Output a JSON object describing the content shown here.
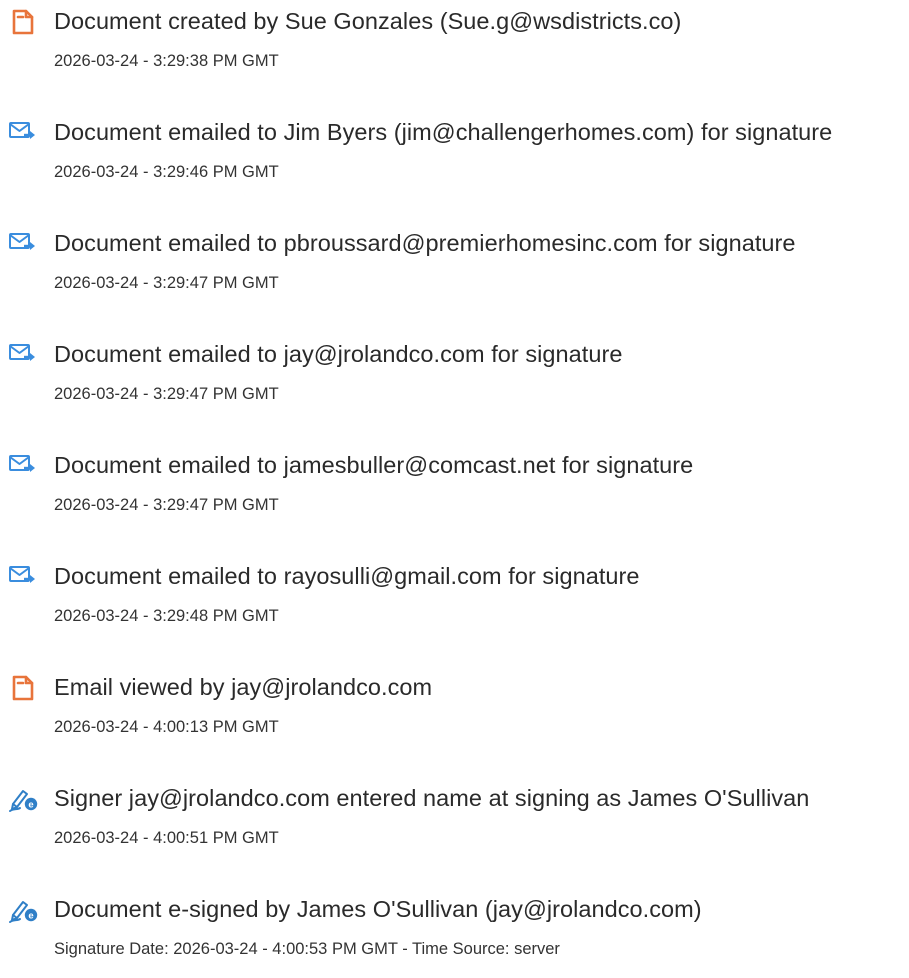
{
  "colors": {
    "doc_icon": "#e8743b",
    "email_icon": "#3a8dde",
    "sign_icon": "#2f7fc7",
    "text": "#2a2a2a"
  },
  "events": [
    {
      "icon": "document-icon",
      "title": "Document created by Sue Gonzales (Sue.g@wsdistricts.co)",
      "timestamp": "2026-03-24 - 3:29:38 PM GMT"
    },
    {
      "icon": "email-sent-icon",
      "title": "Document emailed to Jim Byers (jim@challengerhomes.com) for signature",
      "timestamp": "2026-03-24 - 3:29:46 PM GMT"
    },
    {
      "icon": "email-sent-icon",
      "title": "Document emailed to pbroussard@premierhomesinc.com for signature",
      "timestamp": "2026-03-24 - 3:29:47 PM GMT"
    },
    {
      "icon": "email-sent-icon",
      "title": "Document emailed to jay@jrolandco.com for signature",
      "timestamp": "2026-03-24 - 3:29:47 PM GMT"
    },
    {
      "icon": "email-sent-icon",
      "title": "Document emailed to jamesbuller@comcast.net for signature",
      "timestamp": "2026-03-24 - 3:29:47 PM GMT"
    },
    {
      "icon": "email-sent-icon",
      "title": "Document emailed to rayosulli@gmail.com for signature",
      "timestamp": "2026-03-24 - 3:29:48 PM GMT"
    },
    {
      "icon": "document-icon",
      "title": "Email viewed by jay@jrolandco.com",
      "timestamp": "2026-03-24 - 4:00:13 PM GMT"
    },
    {
      "icon": "e-sign-icon",
      "title": "Signer jay@jrolandco.com entered name at signing as James O'Sullivan",
      "timestamp": "2026-03-24 - 4:00:51 PM GMT"
    },
    {
      "icon": "e-sign-icon",
      "title": "Document e-signed by James O'Sullivan (jay@jrolandco.com)",
      "timestamp": "Signature Date: 2026-03-24 - 4:00:53 PM GMT - Time Source: server"
    }
  ]
}
